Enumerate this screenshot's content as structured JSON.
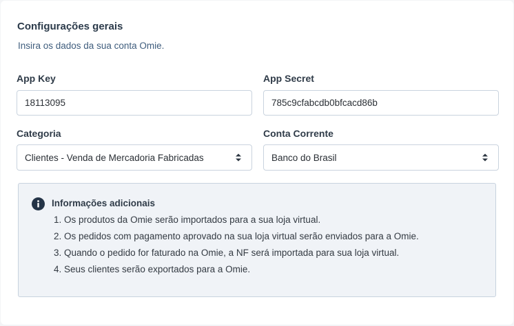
{
  "section": {
    "title": "Configurações gerais",
    "subtitle": "Insira os dados da sua conta Omie."
  },
  "fields": {
    "app_key": {
      "label": "App Key",
      "value": "18113095"
    },
    "app_secret": {
      "label": "App Secret",
      "value": "785c9cfabcdb0bfcacd86b"
    },
    "categoria": {
      "label": "Categoria",
      "value": "Clientes - Venda de Mercadoria Fabricadas"
    },
    "conta_corrente": {
      "label": "Conta Corrente",
      "value": "Banco do Brasil"
    }
  },
  "info": {
    "icon": "info-icon",
    "title": "Informações adicionais",
    "items": [
      "1. Os produtos da Omie serão importados para a sua loja virtual.",
      "2. Os pedidos com pagamento aprovado na sua loja virtual serão enviados para a Omie.",
      "3. Quando o pedido for faturado na Omie, a NF será importada para sua loja virtual.",
      "4. Seus clientes serão exportados para a Omie."
    ]
  },
  "colors": {
    "info_background": "#f0f3f7",
    "field_border": "#c9d3de",
    "subtitle": "#3f5d7d"
  }
}
